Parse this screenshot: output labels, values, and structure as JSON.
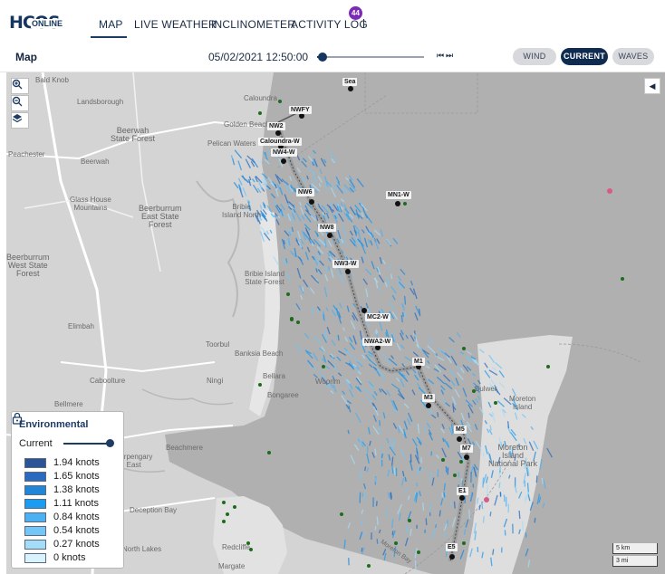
{
  "logo": {
    "mark": "HCOS",
    "sub": "ONLINE"
  },
  "nav": {
    "items": [
      {
        "id": "map",
        "label": "MAP",
        "active": true
      },
      {
        "id": "live-weather",
        "label": "LIVE WEATHER",
        "active": false
      },
      {
        "id": "inclinometer",
        "label": "INCLINOMETER",
        "active": false
      },
      {
        "id": "activity-log",
        "label": "ACTIVITY LOG",
        "active": false
      }
    ],
    "activity_badge": "44"
  },
  "toolbar": {
    "title": "Map",
    "datetime": "05/02/2021 12:50:00",
    "timeline_progress": 0.05,
    "step_back_icon": "skip-back-icon",
    "step_forward_icon": "skip-forward-icon",
    "layers": [
      {
        "label": "WIND",
        "active": false
      },
      {
        "label": "CURRENT",
        "active": true
      },
      {
        "label": "WAVES",
        "active": false
      }
    ]
  },
  "map": {
    "places": [
      {
        "label": "Bald Knob"
      },
      {
        "label": "Landsborough"
      },
      {
        "label": "Beerwah\nState Forest"
      },
      {
        "label": "Caloundra"
      },
      {
        "label": "Golden Beach"
      },
      {
        "label": "Pelican Waters"
      },
      {
        "label": "Peachester"
      },
      {
        "label": "Beerwah"
      },
      {
        "label": "Glass House\nMountains"
      },
      {
        "label": "Beerburrum\nEast State\nForest"
      },
      {
        "label": "Bribie\nIsland North"
      },
      {
        "label": "Beerburrum\nWest State\nForest"
      },
      {
        "label": "Bribie Island\nState Forest"
      },
      {
        "label": "Elimbah"
      },
      {
        "label": "Toorbul"
      },
      {
        "label": "Banksia Beach"
      },
      {
        "label": "Caboolture"
      },
      {
        "label": "Ningi"
      },
      {
        "label": "Bellara"
      },
      {
        "label": "Bongaree"
      },
      {
        "label": "Woorim"
      },
      {
        "label": "Bellmere"
      },
      {
        "label": "Beachmere"
      },
      {
        "label": "Burpengary\nEast"
      },
      {
        "label": "Deception Bay"
      },
      {
        "label": "North Lakes"
      },
      {
        "label": "Redcliffe"
      },
      {
        "label": "Margate"
      },
      {
        "label": "Moreton\nIsland"
      },
      {
        "label": "Moreton\nIsland\nNational Park"
      },
      {
        "label": "Bulwer"
      },
      {
        "label": "Moreton Bay"
      }
    ],
    "stations": [
      "Sea",
      "NWFY",
      "NW2",
      "Caloundra-W",
      "NW4-W",
      "NW6",
      "MN1-W",
      "NW8",
      "NW3-W",
      "MC2-W",
      "NWA2-W",
      "M1",
      "M3",
      "M5",
      "M7",
      "E1",
      "E5"
    ],
    "scale": [
      "5 km",
      "3 mi"
    ],
    "zoom_in_icon": "zoom-in-icon",
    "zoom_out_icon": "zoom-out-icon",
    "layers_icon": "layers-icon",
    "collapse_icon": "chevron-left-icon"
  },
  "legend": {
    "title": "Environmental",
    "layer_label": "Current",
    "layer_opacity": 1.0,
    "entries": [
      {
        "label": "1.94 knots",
        "color": "#2b5496"
      },
      {
        "label": "1.65 knots",
        "color": "#2a6bbf"
      },
      {
        "label": "1.38 knots",
        "color": "#1f86d8"
      },
      {
        "label": "1.11 knots",
        "color": "#1c9cf0"
      },
      {
        "label": "0.84 knots",
        "color": "#4bb1f3"
      },
      {
        "label": "0.54 knots",
        "color": "#73c6f6"
      },
      {
        "label": "0.27 knots",
        "color": "#a5ddf9"
      },
      {
        "label": "0 knots",
        "color": "#d8f3fd"
      }
    ]
  }
}
